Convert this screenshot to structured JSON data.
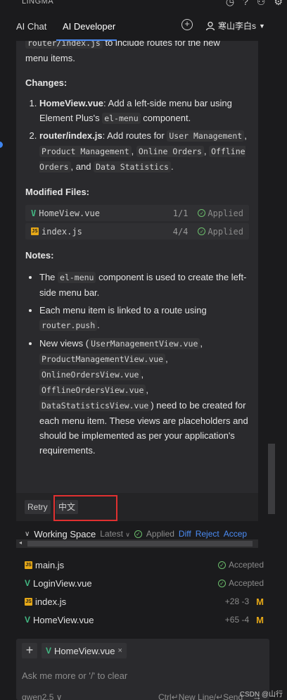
{
  "topbar": {
    "title": "LINGMA"
  },
  "tabs": {
    "chat": "AI Chat",
    "developer": "AI Developer"
  },
  "user": {
    "name": "寒山李白s"
  },
  "message": {
    "intro_code": "router/index.js",
    "intro_text_1": " to include routes for the new",
    "intro_text_2": "menu items.",
    "changes_heading": "Changes:",
    "change1_bold": "HomeView.vue",
    "change1_text_a": ": Add a left-side menu bar using Element Plus's ",
    "change1_code": "el-menu",
    "change1_text_b": " component.",
    "change2_bold": "router/index.js",
    "change2_text_a": ": Add routes for ",
    "change2_code1": "User Management",
    "change2_sep1": ", ",
    "change2_code2": "Product Management",
    "change2_sep2": ", ",
    "change2_code3": "Online Orders",
    "change2_sep3": ", ",
    "change2_code4": "Offline Orders",
    "change2_sep4": ", and ",
    "change2_code5": "Data Statistics",
    "change2_end": ".",
    "modified_heading": "Modified Files:",
    "files": [
      {
        "name": "HomeView.vue",
        "count": "1/1",
        "status": "Applied"
      },
      {
        "name": "index.js",
        "count": "4/4",
        "status": "Applied"
      }
    ],
    "notes_heading": "Notes:",
    "note1_a": "The ",
    "note1_code": "el-menu",
    "note1_b": " component is used to create the left-side menu bar.",
    "note2_a": "Each menu item is linked to a route using ",
    "note2_code": "router.push",
    "note2_b": ".",
    "note3_a": "New views (",
    "note3_code1": "UserManagementView.vue",
    "note3_code2": "ProductManagementView.vue",
    "note3_code3": "OnlineOrdersView.vue",
    "note3_code4": "OfflineOrdersView.vue",
    "note3_code5": "DataStatisticsView.vue",
    "note3_b": ") need to be created for each menu item. These views are placeholders and should be implemented as per your application's requirements."
  },
  "actions": {
    "retry": "Retry",
    "chinese": "中文"
  },
  "workspace": {
    "title": "Working Space",
    "latest": "Latest",
    "applied": "Applied",
    "diff": "Diff",
    "reject": "Reject",
    "accept": "Accep",
    "rows": [
      {
        "name": "main.js",
        "status": "Accepted"
      },
      {
        "name": "LoginView.vue",
        "status": "Accepted"
      },
      {
        "name": "index.js",
        "diff": "+28 -3",
        "mark": "M"
      },
      {
        "name": "HomeView.vue",
        "diff": "+65 -4",
        "mark": "M"
      }
    ]
  },
  "input": {
    "chip": "HomeView.vue",
    "placeholder": "Ask me more or '/' to clear",
    "model": "qwen2.5",
    "shortcut": "Ctrl↵New Line/↵Send"
  },
  "watermark": "CSDN @山行"
}
